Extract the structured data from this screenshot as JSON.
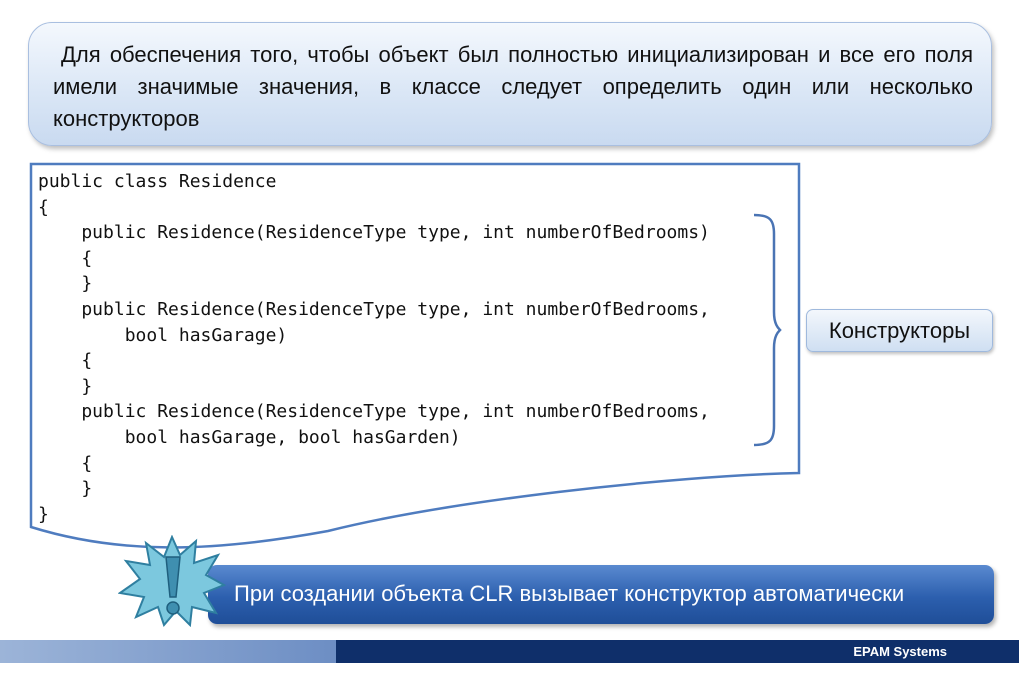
{
  "top_note": {
    "text": "Для обеспечения того, чтобы объект был полностью инициализирован и все его поля имели значимые значения, в классе следует определить один или несколько конструкторов"
  },
  "code": {
    "lines": [
      "public class Residence",
      "{",
      "    public Residence(ResidenceType type, int numberOfBedrooms)",
      "    {",
      "    }",
      "    public Residence(ResidenceType type, int numberOfBedrooms,",
      "        bool hasGarage)",
      "    {",
      "    }",
      "    public Residence(ResidenceType type, int numberOfBedrooms,",
      "        bool hasGarage, bool hasGarden)",
      "    {",
      "    }",
      "}"
    ]
  },
  "label": {
    "text": "Конструкторы"
  },
  "callout": {
    "text": "При создании объекта CLR вызывает конструктор автоматически"
  },
  "footer": {
    "company": "EPAM Systems"
  },
  "colors": {
    "accent_blue": "#2c5fae",
    "footer_dark": "#0f2f6a",
    "brace_blue": "#4a74b4",
    "burst_teal": "#4aa6c4"
  }
}
